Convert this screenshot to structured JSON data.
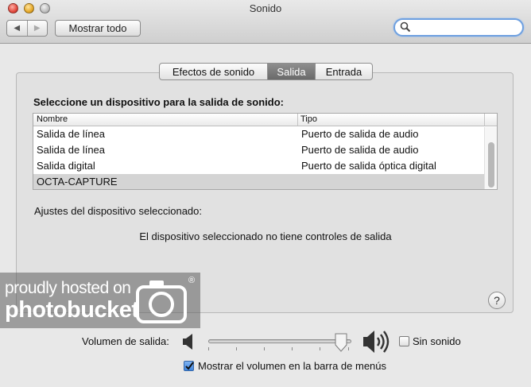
{
  "window": {
    "title": "Sonido"
  },
  "toolbar": {
    "back_glyph": "◀",
    "forward_glyph": "▶",
    "show_all_label": "Mostrar todo",
    "search_placeholder": ""
  },
  "tabs": [
    {
      "label": "Efectos de sonido",
      "selected": false
    },
    {
      "label": "Salida",
      "selected": true
    },
    {
      "label": "Entrada",
      "selected": false
    }
  ],
  "output": {
    "heading": "Seleccione un dispositivo para la salida de sonido:",
    "columns": [
      "Nombre",
      "Tipo"
    ],
    "rows": [
      {
        "name": "Salida de línea",
        "type": "Puerto de salida de audio",
        "selected": false
      },
      {
        "name": "Salida de línea",
        "type": "Puerto de salida de audio",
        "selected": false
      },
      {
        "name": "Salida digital",
        "type": "Puerto de salida óptica digital",
        "selected": false
      },
      {
        "name": "OCTA-CAPTURE",
        "type": "",
        "selected": true
      }
    ],
    "settings_heading": "Ajustes del dispositivo seleccionado:",
    "no_controls_text": "El dispositivo seleccionado no tiene controles de salida",
    "help_label": "?"
  },
  "volume": {
    "label": "Volumen de salida:",
    "level": 0.93,
    "mute_label": "Sin sonido",
    "mute_checked": false,
    "show_in_menubar_label": "Mostrar el volumen en la barra de menús",
    "show_in_menubar_checked": true
  },
  "watermark": {
    "line1": "proudly hosted on",
    "line2": "photobucket",
    "reg": "®"
  },
  "colors": {
    "selected_tab": "#7a7a7a",
    "selected_row": "#d4d4d4",
    "search_focus": "#6ea0e0",
    "checkbox_checked": "#3f86e0"
  }
}
